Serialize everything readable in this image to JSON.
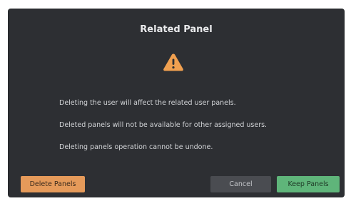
{
  "dialog": {
    "title": "Related Panel",
    "icon": "warning-icon",
    "messages": [
      "Deleting the user will affect the related user panels.",
      "Deleted panels will not be available for other assigned users.",
      "Deleting panels operation cannot be undone."
    ],
    "buttons": {
      "delete_label": "Delete Panels",
      "cancel_label": "Cancel",
      "keep_label": "Keep Panels"
    }
  },
  "colors": {
    "dialog_background": "#2d2f33",
    "warning": "#f0a050",
    "delete_button": "#e59a5a",
    "cancel_button": "#4a4c51",
    "keep_button": "#5fb57a"
  }
}
